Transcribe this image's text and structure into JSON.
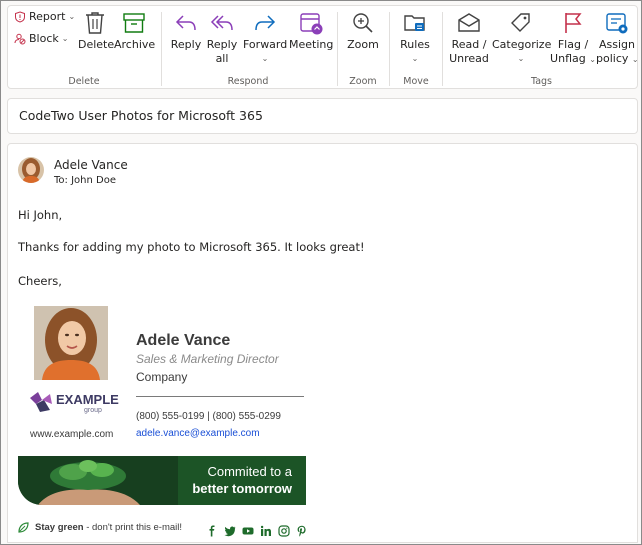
{
  "ribbon": {
    "delete_group": {
      "label": "Delete",
      "report": "Report",
      "block": "Block",
      "delete": "Delete",
      "archive": "Archive"
    },
    "respond_group": {
      "label": "Respond",
      "reply": "Reply",
      "reply_all_1": "Reply",
      "reply_all_2": "all",
      "forward": "Forward",
      "meeting": "Meeting"
    },
    "zoom_group": {
      "label": "Zoom",
      "zoom": "Zoom"
    },
    "move_group": {
      "label": "Move",
      "rules": "Rules"
    },
    "tags_group": {
      "label": "Tags",
      "read_1": "Read /",
      "read_2": "Unread",
      "categorize": "Categorize",
      "flag_1": "Flag /",
      "flag_2": "Unflag",
      "assign_1": "Assign",
      "assign_2": "policy"
    }
  },
  "subject": "CodeTwo User Photos for Microsoft 365",
  "message": {
    "sender": "Adele Vance",
    "to": "To: John Doe",
    "greeting": "Hi John,",
    "body": "Thanks for adding my photo to Microsoft 365. It looks great!",
    "closing": "Cheers,"
  },
  "signature": {
    "name": "Adele Vance",
    "title": "Sales & Marketing Director",
    "company": "Company",
    "phone": "(800) 555-0199 | (800) 555-0299",
    "email": "adele.vance@example.com",
    "logo_text": "EXAMPLE",
    "logo_sub": "group",
    "website": "www.example.com",
    "banner_line1": "Commited to a",
    "banner_line2": "better tomorrow",
    "stay_green": "Stay green",
    "stay_green_rest": " - don't print this e-mail!"
  },
  "colors": {
    "accent": "#0f6cbd",
    "meeting_purple": "#8b3fb8",
    "flag_red": "#c4314b",
    "banner_green": "#1c5426",
    "link": "#1a4fd6"
  }
}
